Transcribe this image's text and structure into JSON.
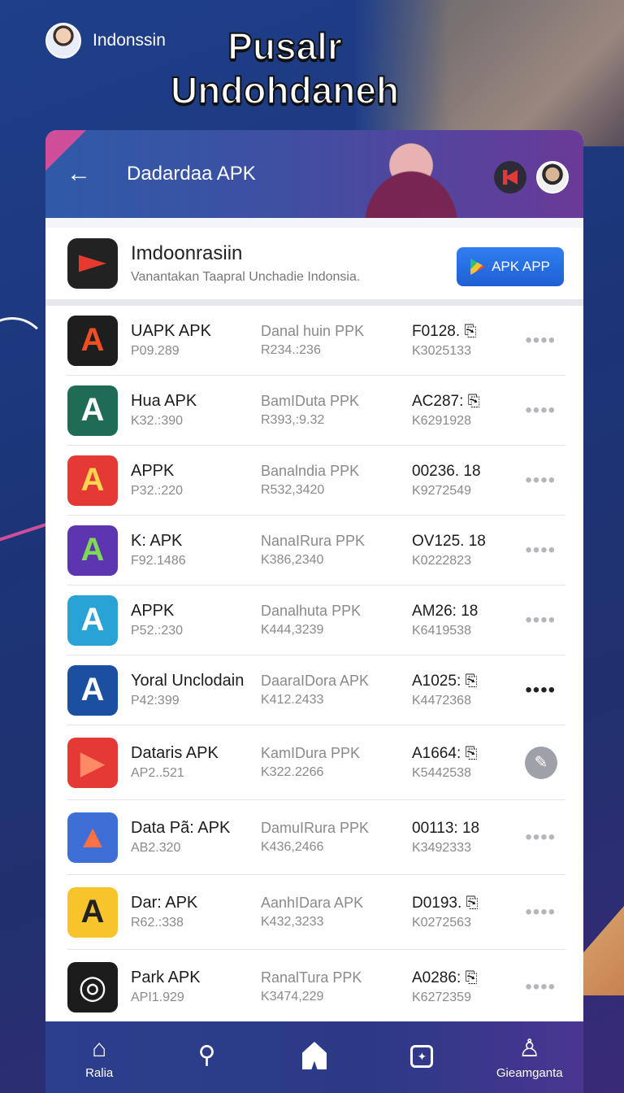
{
  "top_user": {
    "name": "Indonssin"
  },
  "hero": {
    "line1": "Pusalr",
    "line2": "Undohdaneh"
  },
  "header": {
    "back": "←",
    "title": "Dadardaa APK"
  },
  "promo": {
    "name": "Imdoonrasiin",
    "description": "Vanantakan Taapral Unchadie Indonsia.",
    "button_label": "APK APP"
  },
  "apps": [
    {
      "name": "UAPK APK",
      "id": "P09.289",
      "source": "Danal huin PPK",
      "source_sub": "R234.:236",
      "code": "F0128. ⎘",
      "code_sub": "K3025133",
      "icon_color": "#1e1e1e",
      "icon_glyph": "A",
      "glyph_color": "#f04e23",
      "action": "more"
    },
    {
      "name": "Hua APK",
      "id": "K32.:390",
      "source": "BamIDuta PPK",
      "source_sub": "R393,:9.32",
      "code": "AC287: ⎘",
      "code_sub": "K6291928",
      "icon_color": "#1f6b55",
      "icon_glyph": "A",
      "glyph_color": "#ffffff",
      "action": "more"
    },
    {
      "name": "APPK",
      "id": "P32.:220",
      "source": "Banalndia PPK",
      "source_sub": "R532,3420",
      "code": "00236. 18",
      "code_sub": "K9272549",
      "icon_color": "#e53935",
      "icon_glyph": "A",
      "glyph_color": "#ffd54f",
      "action": "more"
    },
    {
      "name": "K: APK",
      "id": "F92.1486",
      "source": "NanaIRura PPK",
      "source_sub": "K386,2340",
      "code": "OV125. 18",
      "code_sub": "K0222823",
      "icon_color": "#5e35b1",
      "icon_glyph": "A",
      "glyph_color": "#7ed957",
      "action": "more"
    },
    {
      "name": "APPK",
      "id": "P52.:230",
      "source": "Danalhuta PPK",
      "source_sub": "K444,3239",
      "code": "AM26: 18",
      "code_sub": "K6419538",
      "icon_color": "#29a3d6",
      "icon_glyph": "A",
      "glyph_color": "#ffffff",
      "action": "more"
    },
    {
      "name": "Yoral Unclodain",
      "id": "P42:399",
      "source": "DaaraIDora APK",
      "source_sub": "K412.2433",
      "code": "A1025: ⎘",
      "code_sub": "K4472368",
      "icon_color": "#1b4fa0",
      "icon_glyph": "A",
      "glyph_color": "#ffffff",
      "action": "more-dark"
    },
    {
      "name": "Dataris APK",
      "id": "AP2..521",
      "source": "KamIDura PPK",
      "source_sub": "K322.2266",
      "code": "A1664: ⎘",
      "code_sub": "K5442538",
      "icon_color": "#e53935",
      "icon_glyph": "▶",
      "glyph_color": "#ff8a65",
      "action": "edit"
    },
    {
      "name": "Data Pã: APK",
      "id": "AB2.320",
      "source": "DamuIRura PPK",
      "source_sub": "K436,2466",
      "code": "00113: 18",
      "code_sub": "K3492333",
      "icon_color": "#3d6fd6",
      "icon_glyph": "▲",
      "glyph_color": "#ff7043",
      "action": "more"
    },
    {
      "name": "Dar: APK",
      "id": "R62.:338",
      "source": "AanhIDara APK",
      "source_sub": "K432,3233",
      "code": "D0193. ⎘",
      "code_sub": "K0272563",
      "icon_color": "#f7c52b",
      "icon_glyph": "A",
      "glyph_color": "#222222",
      "action": "more"
    },
    {
      "name": "Park APK",
      "id": "API1.929",
      "source": "RanalTura PPK",
      "source_sub": "K3474,229",
      "code": "A0286: ⎘",
      "code_sub": "K6272359",
      "icon_color": "#1c1c1c",
      "icon_glyph": "◎",
      "glyph_color": "#ffffff",
      "action": "more"
    }
  ],
  "nav": [
    {
      "label": "Ralia",
      "icon": "home-outline-icon"
    },
    {
      "label": "",
      "icon": "search-icon"
    },
    {
      "label": "",
      "icon": "home-filled-icon"
    },
    {
      "label": "",
      "icon": "sparkle-box-icon"
    },
    {
      "label": "Gieamganta",
      "icon": "profile-pin-icon"
    }
  ],
  "more_glyph": "••••",
  "edit_glyph": "✎"
}
